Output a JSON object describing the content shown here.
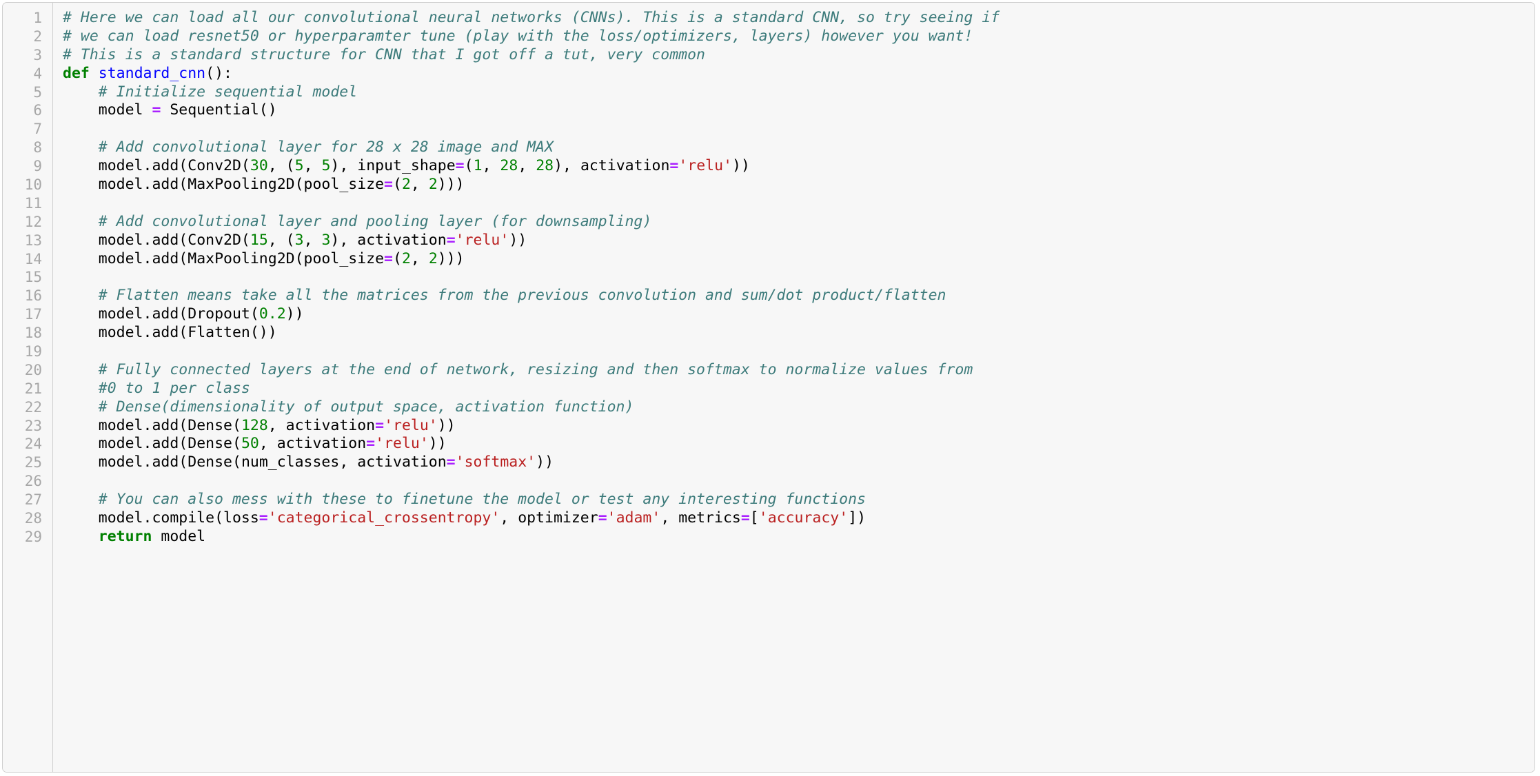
{
  "card": {
    "background": "#f7f7f7",
    "border_color": "#cfcfcf",
    "gutter_background": "#f7f7f7",
    "gutter_text_color": "#a7a7a7"
  },
  "theme": {
    "name": "pygments-default",
    "comment": "#3D7B7B",
    "keyword": "#008000",
    "function_name": "#0000FF",
    "number": "#008000",
    "string": "#BA2121",
    "operator": "#AA22FF",
    "plain": "#000000"
  },
  "language": "python",
  "line_numbers": [
    "1",
    "2",
    "3",
    "4",
    "5",
    "6",
    "7",
    "8",
    "9",
    "10",
    "11",
    "12",
    "13",
    "14",
    "15",
    "16",
    "17",
    "18",
    "19",
    "20",
    "21",
    "22",
    "23",
    "24",
    "25",
    "26",
    "27",
    "28",
    "29"
  ],
  "lines": [
    {
      "n": "1",
      "text": "# Here we can load all our convolutional neural networks (CNNs). This is a standard CNN, so try seeing if",
      "tokens": [
        {
          "t": "c",
          "v": "# Here we can load all our convolutional neural networks (CNNs). This is a standard CNN, so try seeing if"
        }
      ]
    },
    {
      "n": "2",
      "text": "# we can load resnet50 or hyperparamter tune (play with the loss/optimizers, layers) however you want!",
      "tokens": [
        {
          "t": "c",
          "v": "# we can load resnet50 or hyperparamter tune (play with the loss/optimizers, layers) however you want!"
        }
      ]
    },
    {
      "n": "3",
      "text": "# This is a standard structure for CNN that I got off a tut, very common",
      "tokens": [
        {
          "t": "c",
          "v": "# This is a standard structure for CNN that I got off a tut, very common"
        }
      ]
    },
    {
      "n": "4",
      "text": "def standard_cnn():",
      "tokens": [
        {
          "t": "k",
          "v": "def"
        },
        {
          "t": "n",
          "v": " "
        },
        {
          "t": "nf",
          "v": "standard_cnn"
        },
        {
          "t": "p",
          "v": "():"
        }
      ]
    },
    {
      "n": "5",
      "text": "    # Initialize sequential model",
      "tokens": [
        {
          "t": "n",
          "v": "    "
        },
        {
          "t": "c",
          "v": "# Initialize sequential model"
        }
      ]
    },
    {
      "n": "6",
      "text": "    model = Sequential()",
      "tokens": [
        {
          "t": "n",
          "v": "    model "
        },
        {
          "t": "o",
          "v": "="
        },
        {
          "t": "n",
          "v": " Sequential"
        },
        {
          "t": "p",
          "v": "()"
        }
      ]
    },
    {
      "n": "7",
      "text": "",
      "tokens": []
    },
    {
      "n": "8",
      "text": "    # Add convolutional layer for 28 x 28 image and MAX",
      "tokens": [
        {
          "t": "n",
          "v": "    "
        },
        {
          "t": "c",
          "v": "# Add convolutional layer for 28 x 28 image and MAX"
        }
      ]
    },
    {
      "n": "9",
      "text": "    model.add(Conv2D(30, (5, 5), input_shape=(1, 28, 28), activation='relu'))",
      "tokens": [
        {
          "t": "n",
          "v": "    model"
        },
        {
          "t": "p",
          "v": "."
        },
        {
          "t": "n",
          "v": "add"
        },
        {
          "t": "p",
          "v": "("
        },
        {
          "t": "n",
          "v": "Conv2D"
        },
        {
          "t": "p",
          "v": "("
        },
        {
          "t": "mi",
          "v": "30"
        },
        {
          "t": "p",
          "v": ","
        },
        {
          "t": "n",
          "v": " ("
        },
        {
          "t": "mi",
          "v": "5"
        },
        {
          "t": "p",
          "v": ","
        },
        {
          "t": "n",
          "v": " "
        },
        {
          "t": "mi",
          "v": "5"
        },
        {
          "t": "p",
          "v": "),"
        },
        {
          "t": "n",
          "v": " input_shape"
        },
        {
          "t": "o",
          "v": "="
        },
        {
          "t": "p",
          "v": "("
        },
        {
          "t": "mi",
          "v": "1"
        },
        {
          "t": "p",
          "v": ","
        },
        {
          "t": "n",
          "v": " "
        },
        {
          "t": "mi",
          "v": "28"
        },
        {
          "t": "p",
          "v": ","
        },
        {
          "t": "n",
          "v": " "
        },
        {
          "t": "mi",
          "v": "28"
        },
        {
          "t": "p",
          "v": "),"
        },
        {
          "t": "n",
          "v": " activation"
        },
        {
          "t": "o",
          "v": "="
        },
        {
          "t": "s",
          "v": "'relu'"
        },
        {
          "t": "p",
          "v": "))"
        }
      ]
    },
    {
      "n": "10",
      "text": "    model.add(MaxPooling2D(pool_size=(2, 2)))",
      "tokens": [
        {
          "t": "n",
          "v": "    model"
        },
        {
          "t": "p",
          "v": "."
        },
        {
          "t": "n",
          "v": "add"
        },
        {
          "t": "p",
          "v": "("
        },
        {
          "t": "n",
          "v": "MaxPooling2D"
        },
        {
          "t": "p",
          "v": "("
        },
        {
          "t": "n",
          "v": "pool_size"
        },
        {
          "t": "o",
          "v": "="
        },
        {
          "t": "p",
          "v": "("
        },
        {
          "t": "mi",
          "v": "2"
        },
        {
          "t": "p",
          "v": ","
        },
        {
          "t": "n",
          "v": " "
        },
        {
          "t": "mi",
          "v": "2"
        },
        {
          "t": "p",
          "v": ")))"
        }
      ]
    },
    {
      "n": "11",
      "text": "",
      "tokens": []
    },
    {
      "n": "12",
      "text": "    # Add convolutional layer and pooling layer (for downsampling)",
      "tokens": [
        {
          "t": "n",
          "v": "    "
        },
        {
          "t": "c",
          "v": "# Add convolutional layer and pooling layer (for downsampling)"
        }
      ]
    },
    {
      "n": "13",
      "text": "    model.add(Conv2D(15, (3, 3), activation='relu'))",
      "tokens": [
        {
          "t": "n",
          "v": "    model"
        },
        {
          "t": "p",
          "v": "."
        },
        {
          "t": "n",
          "v": "add"
        },
        {
          "t": "p",
          "v": "("
        },
        {
          "t": "n",
          "v": "Conv2D"
        },
        {
          "t": "p",
          "v": "("
        },
        {
          "t": "mi",
          "v": "15"
        },
        {
          "t": "p",
          "v": ","
        },
        {
          "t": "n",
          "v": " ("
        },
        {
          "t": "mi",
          "v": "3"
        },
        {
          "t": "p",
          "v": ","
        },
        {
          "t": "n",
          "v": " "
        },
        {
          "t": "mi",
          "v": "3"
        },
        {
          "t": "p",
          "v": "),"
        },
        {
          "t": "n",
          "v": " activation"
        },
        {
          "t": "o",
          "v": "="
        },
        {
          "t": "s",
          "v": "'relu'"
        },
        {
          "t": "p",
          "v": "))"
        }
      ]
    },
    {
      "n": "14",
      "text": "    model.add(MaxPooling2D(pool_size=(2, 2)))",
      "tokens": [
        {
          "t": "n",
          "v": "    model"
        },
        {
          "t": "p",
          "v": "."
        },
        {
          "t": "n",
          "v": "add"
        },
        {
          "t": "p",
          "v": "("
        },
        {
          "t": "n",
          "v": "MaxPooling2D"
        },
        {
          "t": "p",
          "v": "("
        },
        {
          "t": "n",
          "v": "pool_size"
        },
        {
          "t": "o",
          "v": "="
        },
        {
          "t": "p",
          "v": "("
        },
        {
          "t": "mi",
          "v": "2"
        },
        {
          "t": "p",
          "v": ","
        },
        {
          "t": "n",
          "v": " "
        },
        {
          "t": "mi",
          "v": "2"
        },
        {
          "t": "p",
          "v": ")))"
        }
      ]
    },
    {
      "n": "15",
      "text": "",
      "tokens": []
    },
    {
      "n": "16",
      "text": "    # Flatten means take all the matrices from the previous convolution and sum/dot product/flatten",
      "tokens": [
        {
          "t": "n",
          "v": "    "
        },
        {
          "t": "c",
          "v": "# Flatten means take all the matrices from the previous convolution and sum/dot product/flatten"
        }
      ]
    },
    {
      "n": "17",
      "text": "    model.add(Dropout(0.2))",
      "tokens": [
        {
          "t": "n",
          "v": "    model"
        },
        {
          "t": "p",
          "v": "."
        },
        {
          "t": "n",
          "v": "add"
        },
        {
          "t": "p",
          "v": "("
        },
        {
          "t": "n",
          "v": "Dropout"
        },
        {
          "t": "p",
          "v": "("
        },
        {
          "t": "mi",
          "v": "0.2"
        },
        {
          "t": "p",
          "v": "))"
        }
      ]
    },
    {
      "n": "18",
      "text": "    model.add(Flatten())",
      "tokens": [
        {
          "t": "n",
          "v": "    model"
        },
        {
          "t": "p",
          "v": "."
        },
        {
          "t": "n",
          "v": "add"
        },
        {
          "t": "p",
          "v": "("
        },
        {
          "t": "n",
          "v": "Flatten"
        },
        {
          "t": "p",
          "v": "())"
        }
      ]
    },
    {
      "n": "19",
      "text": "",
      "tokens": []
    },
    {
      "n": "20",
      "text": "    # Fully connected layers at the end of network, resizing and then softmax to normalize values from",
      "tokens": [
        {
          "t": "n",
          "v": "    "
        },
        {
          "t": "c",
          "v": "# Fully connected layers at the end of network, resizing and then softmax to normalize values from"
        }
      ]
    },
    {
      "n": "21",
      "text": "    #0 to 1 per class",
      "tokens": [
        {
          "t": "n",
          "v": "    "
        },
        {
          "t": "c",
          "v": "#0 to 1 per class"
        }
      ]
    },
    {
      "n": "22",
      "text": "    # Dense(dimensionality of output space, activation function)",
      "tokens": [
        {
          "t": "n",
          "v": "    "
        },
        {
          "t": "c",
          "v": "# Dense(dimensionality of output space, activation function)"
        }
      ]
    },
    {
      "n": "23",
      "text": "    model.add(Dense(128, activation='relu'))",
      "tokens": [
        {
          "t": "n",
          "v": "    model"
        },
        {
          "t": "p",
          "v": "."
        },
        {
          "t": "n",
          "v": "add"
        },
        {
          "t": "p",
          "v": "("
        },
        {
          "t": "n",
          "v": "Dense"
        },
        {
          "t": "p",
          "v": "("
        },
        {
          "t": "mi",
          "v": "128"
        },
        {
          "t": "p",
          "v": ","
        },
        {
          "t": "n",
          "v": " activation"
        },
        {
          "t": "o",
          "v": "="
        },
        {
          "t": "s",
          "v": "'relu'"
        },
        {
          "t": "p",
          "v": "))"
        }
      ]
    },
    {
      "n": "24",
      "text": "    model.add(Dense(50, activation='relu'))",
      "tokens": [
        {
          "t": "n",
          "v": "    model"
        },
        {
          "t": "p",
          "v": "."
        },
        {
          "t": "n",
          "v": "add"
        },
        {
          "t": "p",
          "v": "("
        },
        {
          "t": "n",
          "v": "Dense"
        },
        {
          "t": "p",
          "v": "("
        },
        {
          "t": "mi",
          "v": "50"
        },
        {
          "t": "p",
          "v": ","
        },
        {
          "t": "n",
          "v": " activation"
        },
        {
          "t": "o",
          "v": "="
        },
        {
          "t": "s",
          "v": "'relu'"
        },
        {
          "t": "p",
          "v": "))"
        }
      ]
    },
    {
      "n": "25",
      "text": "    model.add(Dense(num_classes, activation='softmax'))",
      "tokens": [
        {
          "t": "n",
          "v": "    model"
        },
        {
          "t": "p",
          "v": "."
        },
        {
          "t": "n",
          "v": "add"
        },
        {
          "t": "p",
          "v": "("
        },
        {
          "t": "n",
          "v": "Dense"
        },
        {
          "t": "p",
          "v": "("
        },
        {
          "t": "n",
          "v": "num_classes"
        },
        {
          "t": "p",
          "v": ","
        },
        {
          "t": "n",
          "v": " activation"
        },
        {
          "t": "o",
          "v": "="
        },
        {
          "t": "s",
          "v": "'softmax'"
        },
        {
          "t": "p",
          "v": "))"
        }
      ]
    },
    {
      "n": "26",
      "text": "",
      "tokens": []
    },
    {
      "n": "27",
      "text": "    # You can also mess with these to finetune the model or test any interesting functions",
      "tokens": [
        {
          "t": "n",
          "v": "    "
        },
        {
          "t": "c",
          "v": "# You can also mess with these to finetune the model or test any interesting functions"
        }
      ]
    },
    {
      "n": "28",
      "text": "    model.compile(loss='categorical_crossentropy', optimizer='adam', metrics=['accuracy'])",
      "tokens": [
        {
          "t": "n",
          "v": "    model"
        },
        {
          "t": "p",
          "v": "."
        },
        {
          "t": "n",
          "v": "compile"
        },
        {
          "t": "p",
          "v": "("
        },
        {
          "t": "n",
          "v": "loss"
        },
        {
          "t": "o",
          "v": "="
        },
        {
          "t": "s",
          "v": "'categorical_crossentropy'"
        },
        {
          "t": "p",
          "v": ","
        },
        {
          "t": "n",
          "v": " optimizer"
        },
        {
          "t": "o",
          "v": "="
        },
        {
          "t": "s",
          "v": "'adam'"
        },
        {
          "t": "p",
          "v": ","
        },
        {
          "t": "n",
          "v": " metrics"
        },
        {
          "t": "o",
          "v": "="
        },
        {
          "t": "p",
          "v": "["
        },
        {
          "t": "s",
          "v": "'accuracy'"
        },
        {
          "t": "p",
          "v": "])"
        }
      ]
    },
    {
      "n": "29",
      "text": "    return model",
      "tokens": [
        {
          "t": "n",
          "v": "    "
        },
        {
          "t": "k",
          "v": "return"
        },
        {
          "t": "n",
          "v": " model"
        }
      ]
    }
  ]
}
